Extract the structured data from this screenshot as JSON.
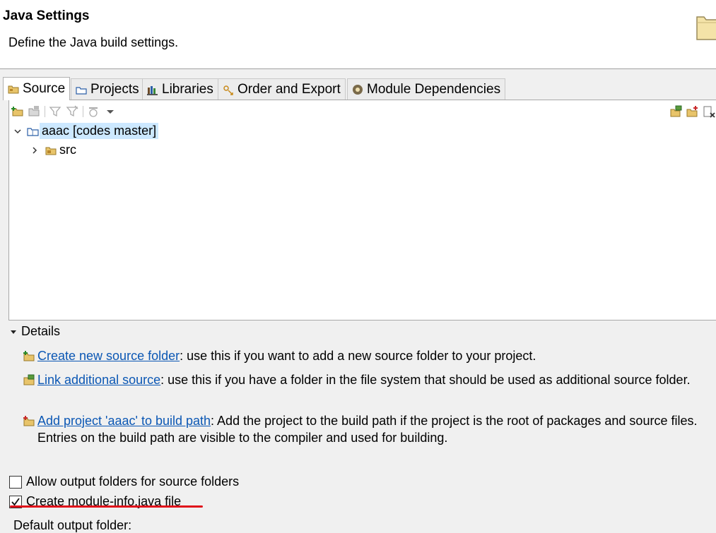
{
  "banner": {
    "title": "Java Settings",
    "description": "Define the Java build settings.",
    "icon": "folder-wizard-icon"
  },
  "tabs": [
    {
      "label": "Source",
      "icon": "source-folder-icon",
      "active": true
    },
    {
      "label": "Projects",
      "icon": "projects-icon",
      "active": false
    },
    {
      "label": "Libraries",
      "icon": "libraries-icon",
      "active": false
    },
    {
      "label": "Order and Export",
      "icon": "order-export-icon",
      "active": false
    },
    {
      "label": "Module Dependencies",
      "icon": "module-icon",
      "active": false
    }
  ],
  "toolbar": {
    "left_icons": [
      "add-source-folder-icon",
      "link-source-icon",
      "filter-icon",
      "filter-edit-icon",
      "remove-icon",
      "view-menu-icon"
    ],
    "right_icons": [
      "link-folder-icon",
      "add-folder-icon",
      "delete-folder-icon"
    ]
  },
  "tree": {
    "project": "aaac [codes master]",
    "child": "src"
  },
  "details": {
    "header": "Details",
    "items": [
      {
        "link": "Create new source folder",
        "text": ": use this if you want to add a new source folder to your project."
      },
      {
        "link": "Link additional source",
        "text": ": use this if you have a folder in the file system that should be used as additional source folder."
      },
      {
        "link": "Add project 'aaac' to build path",
        "text": ": Add the project to the build path if the project is the root of packages and source files. Entries on the build path are visible to the compiler and used for building."
      }
    ]
  },
  "options": {
    "allow_output": {
      "label": "Allow output folders for source folders",
      "checked": false
    },
    "module_info": {
      "label": "Create module-info.java file",
      "checked": true
    }
  },
  "default_output_label": "Default output folder:",
  "colors": {
    "link": "#0b57b4",
    "selection": "#cce8ff",
    "annotation": "#e0101a"
  }
}
